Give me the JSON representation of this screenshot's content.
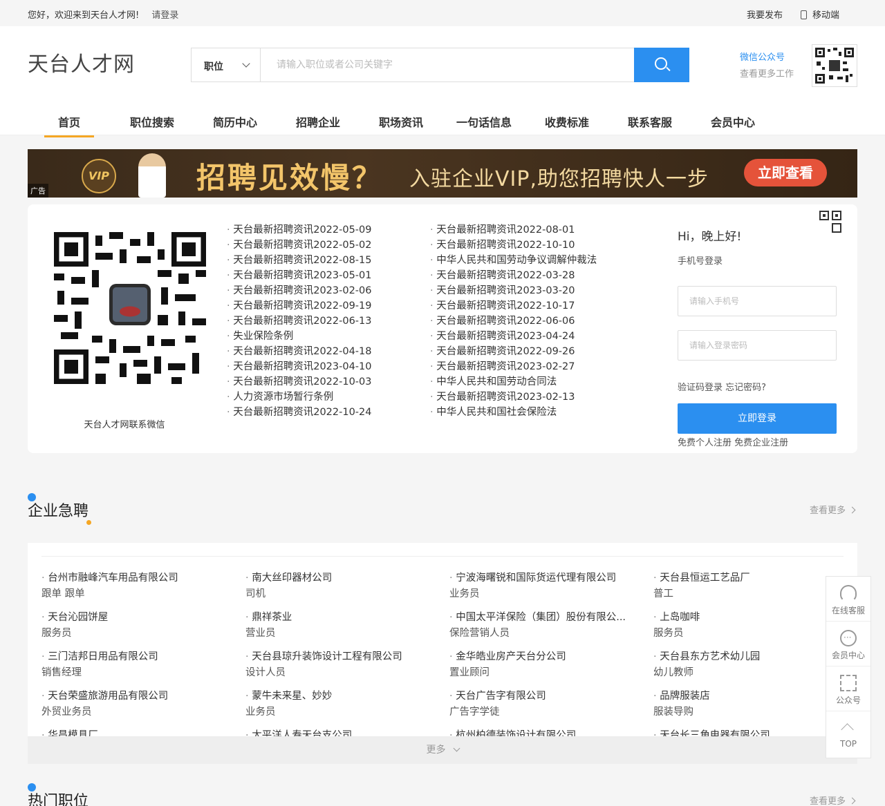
{
  "topbar": {
    "welcome": "您好，欢迎来到天台人才网!",
    "login": "请登录",
    "publish": "我要发布",
    "mobile": "移动端"
  },
  "header": {
    "logo": "天台人才网",
    "search": {
      "type": "职位",
      "placeholder": "请输入职位或者公司关键字"
    },
    "wechat_title": "微信公众号",
    "wechat_sub": "查看更多工作"
  },
  "nav": [
    "首页",
    "职位搜索",
    "简历中心",
    "招聘企业",
    "职场资讯",
    "一句话信息",
    "收费标准",
    "联系客服",
    "会员中心"
  ],
  "banner": {
    "headline": "招聘见效慢？",
    "sub": "入驻企业VIP,助您招聘快人一步",
    "cta": "立即查看",
    "ad_tag": "广告",
    "vip": "VIP"
  },
  "info": {
    "qr_caption": "天台人才网联系微信",
    "news_col1": [
      "天台最新招聘资讯2022-05-09",
      "天台最新招聘资讯2022-05-02",
      "天台最新招聘资讯2022-08-15",
      "天台最新招聘资讯2023-05-01",
      "天台最新招聘资讯2023-02-06",
      "天台最新招聘资讯2022-09-19",
      "天台最新招聘资讯2022-06-13",
      "失业保险条例",
      "天台最新招聘资讯2022-04-18",
      "天台最新招聘资讯2023-04-10",
      "天台最新招聘资讯2022-10-03",
      "人力资源市场暂行条例",
      "天台最新招聘资讯2022-10-24"
    ],
    "news_col2": [
      "天台最新招聘资讯2022-08-01",
      "天台最新招聘资讯2022-10-10",
      "中华人民共和国劳动争议调解仲裁法",
      "天台最新招聘资讯2022-03-28",
      "天台最新招聘资讯2023-03-20",
      "天台最新招聘资讯2022-10-17",
      "天台最新招聘资讯2022-06-06",
      "天台最新招聘资讯2023-04-24",
      "天台最新招聘资讯2022-09-26",
      "天台最新招聘资讯2023-02-27",
      "中华人民共和国劳动合同法",
      "天台最新招聘资讯2023-02-13",
      "中华人民共和国社会保险法"
    ]
  },
  "login": {
    "greeting": "Hi，晚上好!",
    "mode": "手机号登录",
    "phone_placeholder": "请输入手机号",
    "password_placeholder": "请输入登录密码",
    "links": "验证码登录 忘记密码?",
    "button": "立即登录",
    "register": "免费个人注册 免费企业注册"
  },
  "urgent": {
    "title": "企业急聘",
    "more": "查看更多",
    "more_bar": "更多",
    "jobs": [
      {
        "company": "台州市融峰汽车用品有限公司",
        "position": "跟单 跟单"
      },
      {
        "company": "南大丝印器材公司",
        "position": "司机"
      },
      {
        "company": "宁波海曙锐和国际货运代理有限公司",
        "position": "业务员"
      },
      {
        "company": "天台县恒运工艺品厂",
        "position": "普工"
      },
      {
        "company": "天台沁园饼屋",
        "position": "服务员"
      },
      {
        "company": "鼎祥茶业",
        "position": "营业员"
      },
      {
        "company": "中国太平洋保险（集团）股份有限公...",
        "position": "保险营销人员"
      },
      {
        "company": "上岛咖啡",
        "position": "服务员"
      },
      {
        "company": "三门洁邦日用品有限公司",
        "position": "销售经理"
      },
      {
        "company": "天台县琼升装饰设计工程有限公司",
        "position": "设计人员"
      },
      {
        "company": "金华皓业房产天台分公司",
        "position": "置业顾问"
      },
      {
        "company": "天台县东方艺术幼儿园",
        "position": "幼儿教师"
      },
      {
        "company": "天台荣盛旅游用品有限公司",
        "position": "外贸业务员"
      },
      {
        "company": "蒙牛未来星、妙妙",
        "position": "业务员"
      },
      {
        "company": "天台广告字有限公司",
        "position": "广告字学徒"
      },
      {
        "company": "品牌服装店",
        "position": "服装导购"
      },
      {
        "company": "华昌模具厂",
        "position": ""
      },
      {
        "company": "太平洋人寿天台支公司",
        "position": ""
      },
      {
        "company": "杭州柏德装饰设计有限公司",
        "position": ""
      },
      {
        "company": "天台长三角电器有限公司",
        "position": ""
      }
    ]
  },
  "hot": {
    "title": "热门职位",
    "more": "查看更多"
  },
  "float": [
    "在线客服",
    "会员中心",
    "公众号",
    "TOP"
  ]
}
